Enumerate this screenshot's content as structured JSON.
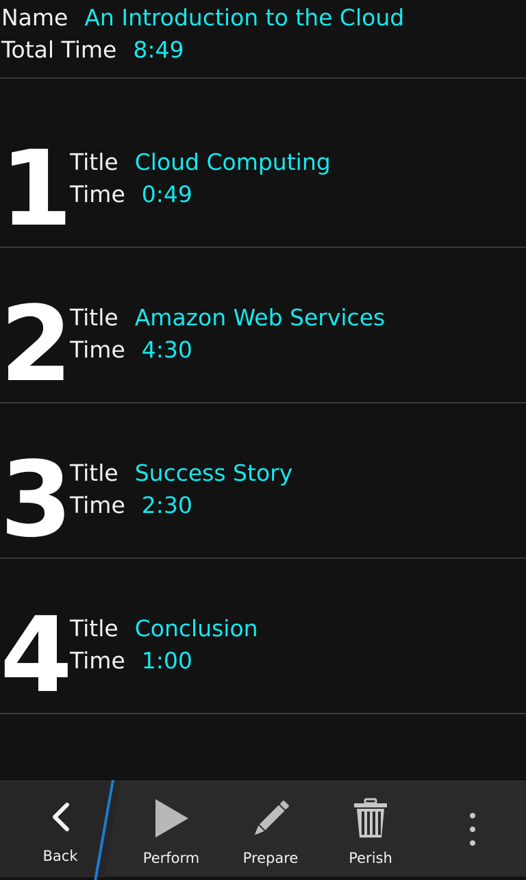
{
  "header": {
    "name_label": "Name",
    "name_value": "An Introduction to the Cloud",
    "total_label": "Total Time",
    "total_value": "8:49"
  },
  "items": [
    {
      "number": "1",
      "title_label": "Title",
      "title": "Cloud Computing",
      "time_label": "Time",
      "time": "0:49"
    },
    {
      "number": "2",
      "title_label": "Title",
      "title": "Amazon Web Services",
      "time_label": "Time",
      "time": "4:30"
    },
    {
      "number": "3",
      "title_label": "Title",
      "title": "Success Story",
      "time_label": "Time",
      "time": "2:30"
    },
    {
      "number": "4",
      "title_label": "Title",
      "title": "Conclusion",
      "time_label": "Time",
      "time": "1:00"
    }
  ],
  "toolbar": {
    "back_label": "Back",
    "perform_label": "Perform",
    "prepare_label": "Prepare",
    "perish_label": "Perish",
    "icons": [
      "chevron-left-icon",
      "play-icon",
      "pencil-icon",
      "trash-icon",
      "overflow-menu-icon"
    ],
    "accent_color": "#1e7bd1"
  },
  "colors": {
    "value_text": "#14e8ef",
    "background": "#121212"
  }
}
